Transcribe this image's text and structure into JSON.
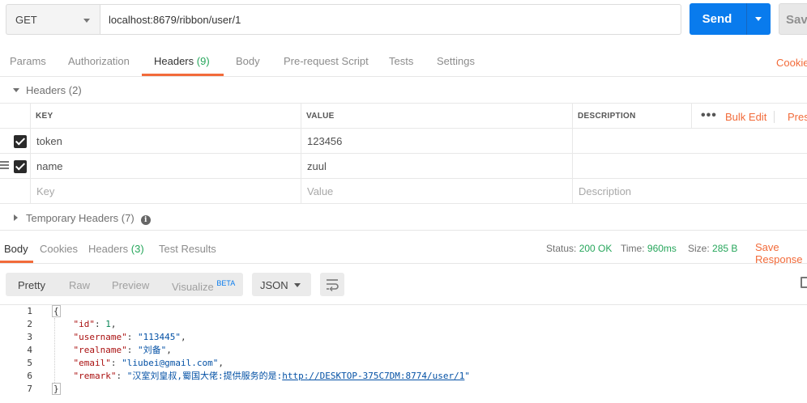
{
  "request": {
    "method": "GET",
    "url": "localhost:8679/ribbon/user/1",
    "send_label": "Send",
    "save_label": "Save"
  },
  "request_tabs": [
    {
      "label": "Params",
      "count": ""
    },
    {
      "label": "Authorization",
      "count": ""
    },
    {
      "label": "Headers",
      "count": "(9)"
    },
    {
      "label": "Body",
      "count": ""
    },
    {
      "label": "Pre-request Script",
      "count": ""
    },
    {
      "label": "Tests",
      "count": ""
    },
    {
      "label": "Settings",
      "count": ""
    }
  ],
  "cookies_link": "Cookies",
  "headers_section": {
    "title": "Headers",
    "count": "(2)",
    "columns": {
      "key": "KEY",
      "value": "VALUE",
      "description": "DESCRIPTION"
    },
    "dots": "•••",
    "bulk_edit": "Bulk Edit",
    "presets": "Presets",
    "rows": [
      {
        "key": "token",
        "value": "123456",
        "description": "",
        "checked": true
      },
      {
        "key": "name",
        "value": "zuul",
        "description": "",
        "checked": true
      }
    ],
    "placeholder": {
      "key": "Key",
      "value": "Value",
      "description": "Description"
    }
  },
  "temporary_headers": {
    "title": "Temporary Headers",
    "count": "(7)"
  },
  "response_tabs": [
    {
      "label": "Body",
      "count": ""
    },
    {
      "label": "Cookies",
      "count": ""
    },
    {
      "label": "Headers",
      "count": "(3)"
    },
    {
      "label": "Test Results",
      "count": ""
    }
  ],
  "response_meta": {
    "status_label": "Status:",
    "status_value": "200 OK",
    "time_label": "Time:",
    "time_value": "960ms",
    "size_label": "Size:",
    "size_value": "285 B",
    "save_response": "Save Response"
  },
  "format_buttons": [
    {
      "label": "Pretty"
    },
    {
      "label": "Raw"
    },
    {
      "label": "Preview"
    },
    {
      "label": "Visualize",
      "badge": "BETA"
    }
  ],
  "language": "JSON",
  "code_lines": [
    {
      "num": "1"
    },
    {
      "num": "2"
    },
    {
      "num": "3"
    },
    {
      "num": "4"
    },
    {
      "num": "5"
    },
    {
      "num": "6"
    },
    {
      "num": "7"
    }
  ],
  "response_body": {
    "open": "{",
    "close": "}",
    "id_key": "\"id\"",
    "id_val": "1",
    "username_key": "\"username\"",
    "username_val": "\"113445\"",
    "realname_key": "\"realname\"",
    "realname_val": "\"刘备\"",
    "email_key": "\"email\"",
    "email_val": "\"liubei@gmail.com\"",
    "remark_key": "\"remark\"",
    "remark_prefix": "\"汉室刘皇叔,蜀国大佬:提供服务的是:",
    "remark_link": "http://DESKTOP-375C7DM:8774/user/1",
    "remark_suffix": "\""
  }
}
